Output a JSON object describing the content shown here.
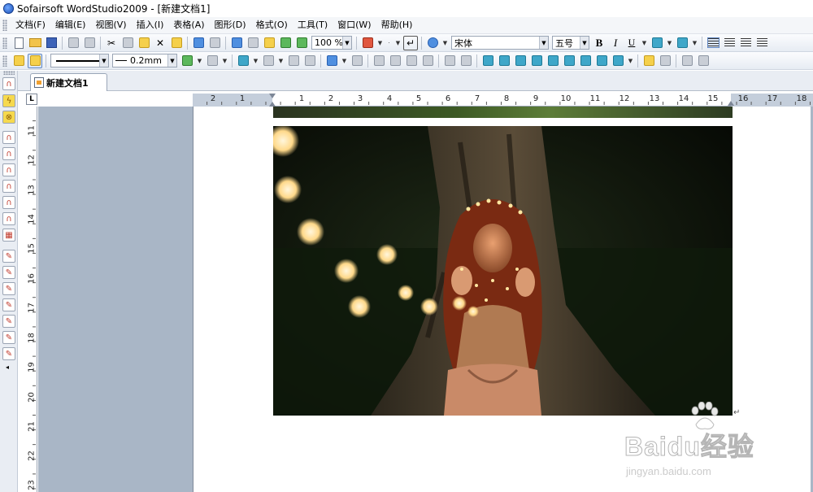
{
  "window": {
    "title": "Sofairsoft WordStudio2009 - [新建文档1]"
  },
  "menu": [
    {
      "id": "file",
      "label": "文档(F)"
    },
    {
      "id": "edit",
      "label": "编辑(E)"
    },
    {
      "id": "view",
      "label": "视图(V)"
    },
    {
      "id": "insert",
      "label": "插入(I)"
    },
    {
      "id": "table",
      "label": "表格(A)"
    },
    {
      "id": "shape",
      "label": "图形(D)"
    },
    {
      "id": "format",
      "label": "格式(O)"
    },
    {
      "id": "tools",
      "label": "工具(T)"
    },
    {
      "id": "window",
      "label": "窗口(W)"
    },
    {
      "id": "help",
      "label": "帮助(H)"
    }
  ],
  "toolbar1": {
    "zoom": "100 %",
    "font_name": "宋体",
    "font_size": "五号",
    "bold": "B",
    "italic": "I",
    "underline": "U"
  },
  "toolbar2": {
    "line_width": "0.2mm"
  },
  "tabs": [
    {
      "label": "新建文档1",
      "active": true
    }
  ],
  "ruler": {
    "corner_symbol": "L",
    "horizontal_labels": [
      "2",
      "1",
      "1",
      "2",
      "3",
      "4",
      "5",
      "6",
      "7",
      "8",
      "9",
      "10",
      "11",
      "12",
      "13",
      "14",
      "15",
      "16",
      "17",
      "18"
    ],
    "vertical_labels": [
      "11",
      "12",
      "13",
      "14",
      "15",
      "16",
      "17",
      "18",
      "19",
      "20",
      "21",
      "22",
      "23"
    ]
  },
  "document": {
    "image": "photo of a girl with string lights sitting beneath a tree at night",
    "paragraph_mark": "↵"
  },
  "watermark": {
    "logo": "Baidu经验",
    "url": "jingyan.baidu.com"
  },
  "colors": {
    "menubar_bg": "#f4f6f9",
    "workspace_bg": "#a9b6c6",
    "ruler_margin": "#c4cedb"
  }
}
